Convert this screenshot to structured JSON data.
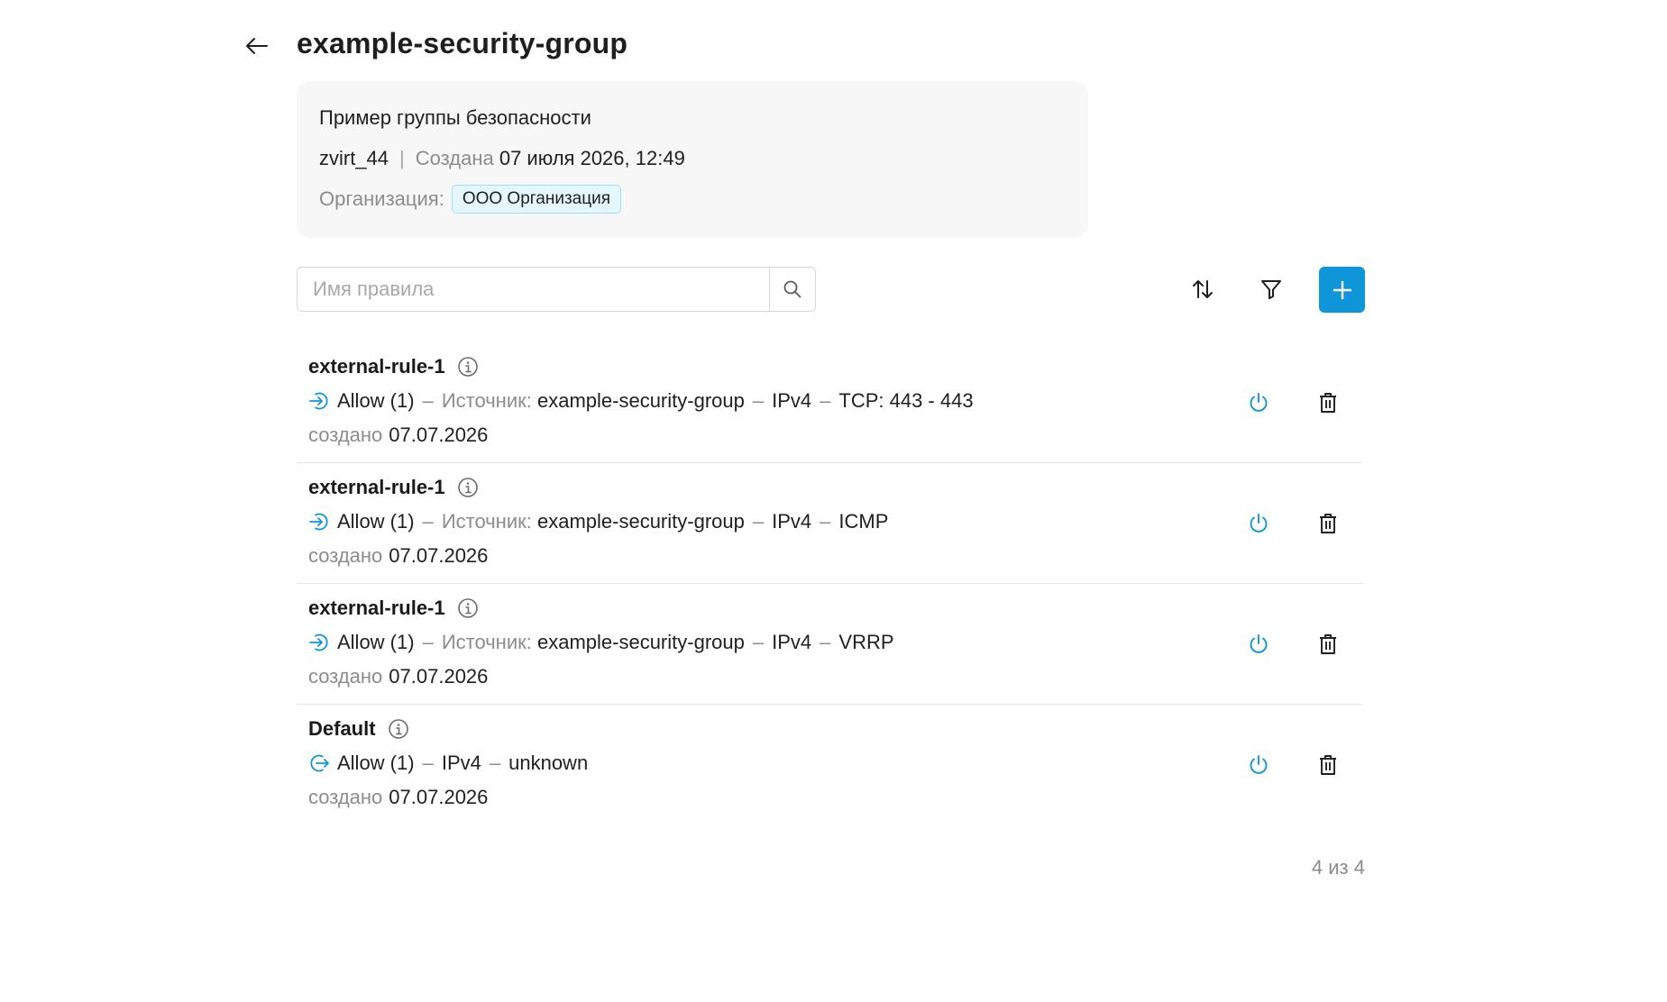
{
  "header": {
    "title": "example-security-group"
  },
  "info_card": {
    "description": "Пример группы безопасности",
    "owner": "zvirt_44",
    "separator": "|",
    "created_label": "Создана",
    "created_value": "07 июля 2026, 12:49",
    "org_label": "Организация:",
    "org_value": "ООО Организация"
  },
  "toolbar": {
    "search_placeholder": "Имя правила",
    "icons": {
      "search": "search-icon",
      "sort": "sort-icon",
      "filter": "filter-icon",
      "add": "plus-icon"
    }
  },
  "colors": {
    "accent": "#0e96d8",
    "badge_bg": "#e3f7fc",
    "badge_border": "#9ee0f0",
    "muted_text": "#8c8c8c"
  },
  "rules": [
    {
      "name": "external-rule-1",
      "direction": "ingress",
      "action": "Allow (1)",
      "source_label": "Источник:",
      "source_value": "example-security-group",
      "ip_version": "IPv4",
      "protocol": "TCP: 443 - 443",
      "created_label": "создано",
      "created_value": "07.07.2026"
    },
    {
      "name": "external-rule-1",
      "direction": "ingress",
      "action": "Allow (1)",
      "source_label": "Источник:",
      "source_value": "example-security-group",
      "ip_version": "IPv4",
      "protocol": "ICMP",
      "created_label": "создано",
      "created_value": "07.07.2026"
    },
    {
      "name": "external-rule-1",
      "direction": "ingress",
      "action": "Allow (1)",
      "source_label": "Источник:",
      "source_value": "example-security-group",
      "ip_version": "IPv4",
      "protocol": "VRRP",
      "created_label": "создано",
      "created_value": "07.07.2026"
    },
    {
      "name": "Default",
      "direction": "egress",
      "action": "Allow (1)",
      "ip_version": "IPv4",
      "protocol": "unknown",
      "created_label": "создано",
      "created_value": "07.07.2026"
    }
  ],
  "pagination": {
    "count_text": "4 из 4"
  }
}
